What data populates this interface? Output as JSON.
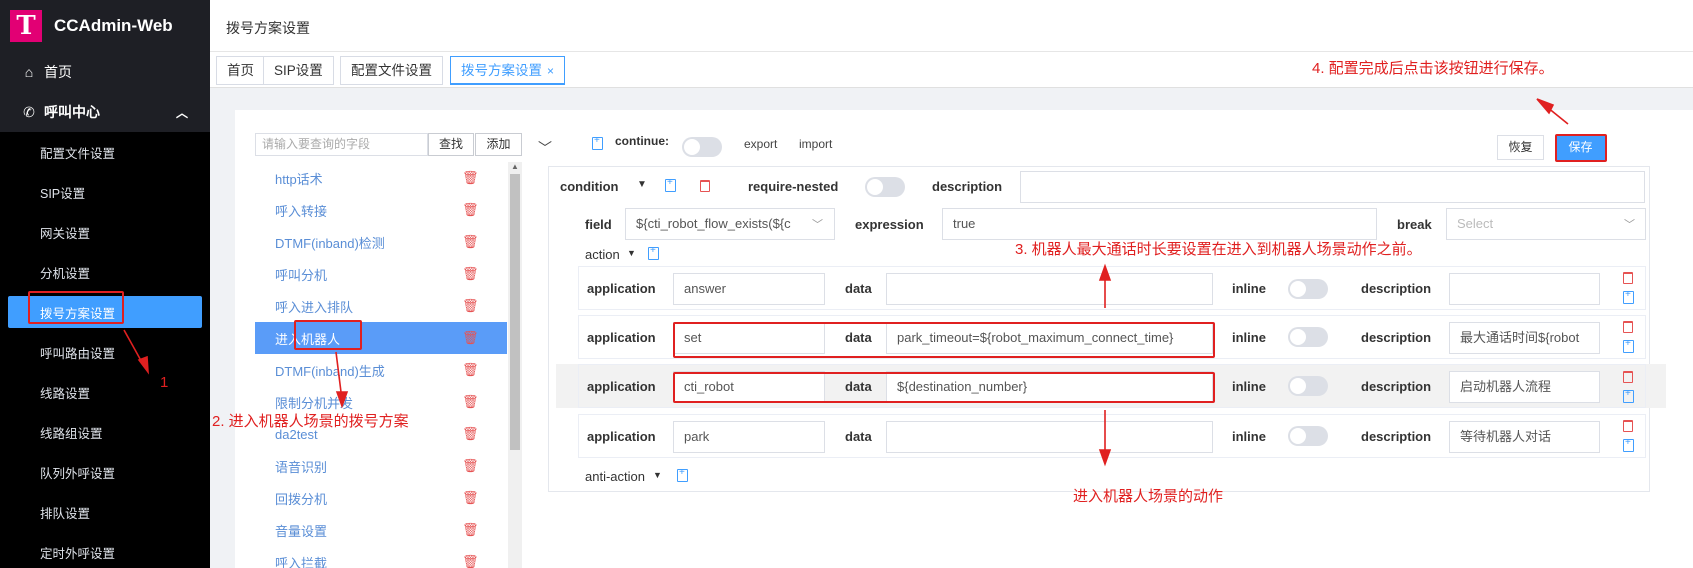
{
  "app": {
    "name": "CCAdmin-Web",
    "logo_letter": "T"
  },
  "sidebar": {
    "home": "首页",
    "call_center": "呼叫中心",
    "items": [
      "配置文件设置",
      "SIP设置",
      "网关设置",
      "分机设置",
      "拨号方案设置",
      "呼叫路由设置",
      "线路设置",
      "线路组设置",
      "队列外呼设置",
      "排队设置",
      "定时外呼设置"
    ]
  },
  "header": {
    "title": "拨号方案设置"
  },
  "tabs": [
    {
      "label": "首页"
    },
    {
      "label": "SIP设置"
    },
    {
      "label": "配置文件设置"
    },
    {
      "label": "拨号方案设置",
      "close": "×"
    }
  ],
  "list_panel": {
    "search_placeholder": "请输入要查询的字段",
    "search_button": "查找",
    "add_button": "添加",
    "items": [
      "http话术",
      "呼入转接",
      "DTMF(inband)检测",
      "呼叫分机",
      "呼入进入排队",
      "进入机器人",
      "DTMF(inband)生成",
      "限制分机并发",
      "da2test",
      "语音识别",
      "回拨分机",
      "音量设置",
      "呼入拦截"
    ]
  },
  "editor": {
    "continue_label": "continue:",
    "export": "export",
    "import": "import",
    "restore_button": "恢复",
    "save_button": "保存",
    "condition_label": "condition",
    "require_nested_label": "require-nested",
    "description_label": "description",
    "field_label": "field",
    "field_value": "${cti_robot_flow_exists(${c",
    "expression_label": "expression",
    "expression_value": "true",
    "break_label": "break",
    "break_placeholder": "Select",
    "action_label": "action",
    "anti_action_label": "anti-action",
    "application_label": "application",
    "data_label": "data",
    "inline_label": "inline",
    "actions": [
      {
        "application": "answer",
        "data": "",
        "description": ""
      },
      {
        "application": "set",
        "data": "park_timeout=${robot_maximum_connect_time}",
        "description": "最大通话时间${robot"
      },
      {
        "application": "cti_robot",
        "data": "${destination_number}",
        "description": "启动机器人流程"
      },
      {
        "application": "park",
        "data": "",
        "description": "等待机器人对话"
      }
    ]
  },
  "annotations": {
    "a1": "1",
    "a2": "2. 进入机器人场景的拨号方案",
    "a3": "3. 机器人最大通话时长要设置在进入到机器人场景动作之前。",
    "a4": "4. 配置完成后点击该按钮进行保存。",
    "a5": "进入机器人场景的动作"
  },
  "colors": {
    "accent": "#409eff",
    "annotation": "#e02020",
    "brand": "#e20074"
  }
}
